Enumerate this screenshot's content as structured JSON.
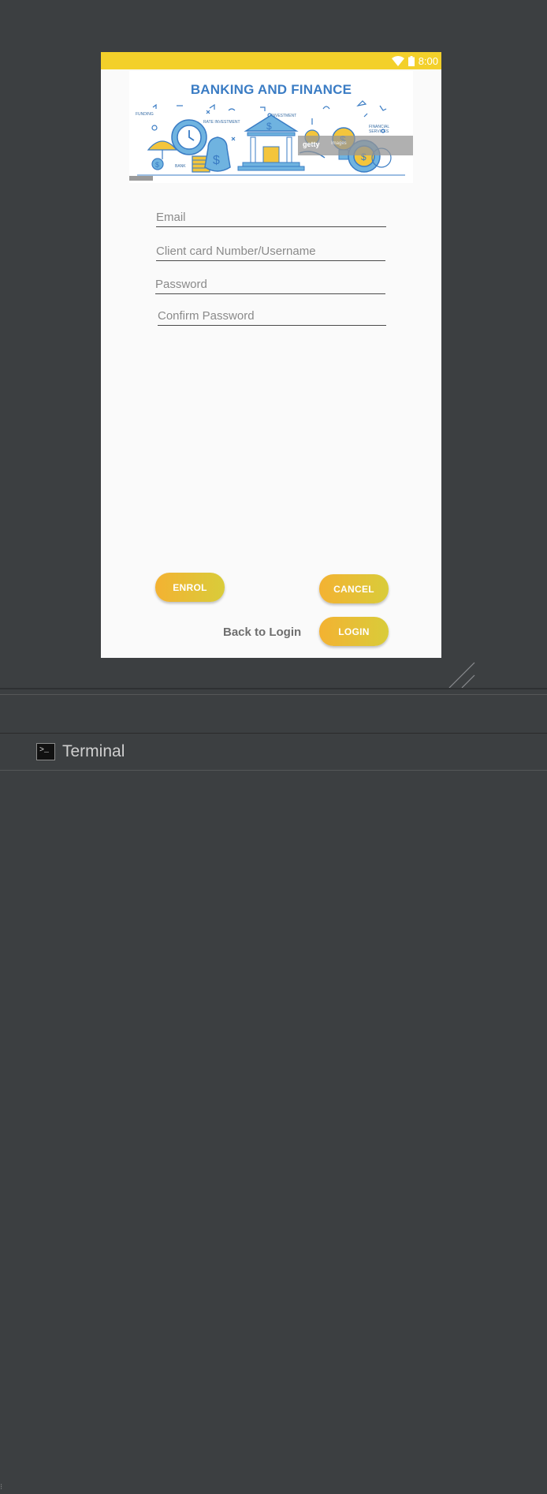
{
  "status_bar": {
    "time": "8:00"
  },
  "banner": {
    "title": "BANKING AND FINANCE",
    "labels": {
      "funding": "FUNDING",
      "rate": "RATE INVESTMENT",
      "investment": "INVESTMENT",
      "services": "FINANCIAL SERVICES",
      "bank": "BANK"
    },
    "watermark": "getty",
    "watermark_id": "Images"
  },
  "form": {
    "email_placeholder": "Email",
    "client_card_placeholder": "Client card Number/Username",
    "password_placeholder": "Password",
    "confirm_password_placeholder": "Confirm Password"
  },
  "buttons": {
    "enrol": "ENROL",
    "cancel": "CANCEL",
    "login": "LOGIN",
    "back_to_login": "Back to Login"
  },
  "bottom_toolbar": {
    "terminal_label": "Terminal"
  },
  "colors": {
    "accent_yellow": "#f3d02a",
    "button_gradient_start": "#f3b232",
    "button_gradient_end": "#d9cc3a",
    "banner_blue": "#3a7cc4"
  }
}
